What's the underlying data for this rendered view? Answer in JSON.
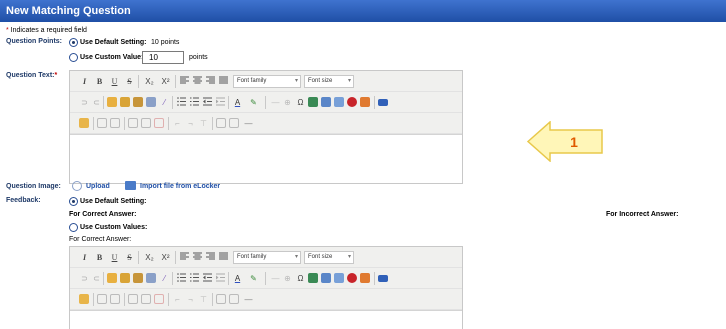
{
  "window": {
    "title": "New Matching Question"
  },
  "required_note": {
    "asterisk": "*",
    "text": " Indicates a required field"
  },
  "question_points": {
    "label": "Question Points:",
    "default_option": "Use Default Setting:",
    "default_value": "10 points",
    "custom_option": "Use Custom Value:",
    "custom_value": "10",
    "custom_unit": "points"
  },
  "question_text": {
    "label": "Question Text:",
    "required_mark": "*"
  },
  "editor_toolbar": {
    "bold": "B",
    "italic": "I",
    "underline": "U",
    "strike": "S",
    "subscript": "X₂",
    "superscript": "X²",
    "font_family": "Font family",
    "font_size": "Font size",
    "chevron": "▾",
    "divider": "—",
    "omega": "Ω"
  },
  "question_image": {
    "label": "Question Image:",
    "upload_label": "Upload",
    "import_label": "Import file from eLocker"
  },
  "feedback": {
    "label": "Feedback:",
    "default_option": "Use Default Setting:",
    "correct_label": "For Correct Answer:",
    "incorrect_label": "For Incorrect Answer:",
    "custom_option": "Use Custom Values:",
    "custom_correct_label": "For Correct Answer:"
  },
  "callout": {
    "number": "1"
  },
  "colors": {
    "title_bar": "#2a5cb8",
    "accent": "#1f3a68",
    "callout_fill": "#fff6b8",
    "callout_text": "#e05a00"
  }
}
